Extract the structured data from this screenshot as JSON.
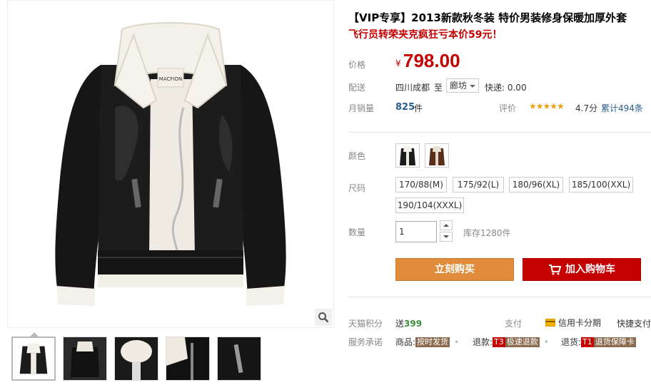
{
  "product": {
    "title": "【VIP专享】2013新款秋冬装 特价男装修身保暖加厚外套",
    "subtitle": "飞行员转荣夹克疯狂亏本价59元！"
  },
  "price": {
    "label": "价格",
    "currency": "¥",
    "value": "798.00"
  },
  "shipping": {
    "label": "配送",
    "from": "四川成都",
    "to_word": "至",
    "destination": "廊坊",
    "postage": "快递: 0.00"
  },
  "sales": {
    "label": "月销量",
    "count": "825",
    "unit": "件",
    "rating_label": "评价",
    "stars": "★★★★★",
    "score": "4.7分",
    "review_count": "累计494条"
  },
  "color": {
    "label": "颜色",
    "options": [
      "black-leather",
      "brown-leather"
    ]
  },
  "size": {
    "label": "尺码",
    "options": [
      "170/88(M)",
      "175/92(L)",
      "180/96(XL)",
      "185/100(XXL)",
      "190/104(XXXL)"
    ]
  },
  "quantity": {
    "label": "数量",
    "value": "1",
    "stock": "库存1280件"
  },
  "buttons": {
    "buy_now": "立刻购买",
    "add_to_cart": "加入购物车"
  },
  "points": {
    "label": "天猫积分",
    "prefix": "送",
    "value": "399"
  },
  "payment": {
    "label": "支付",
    "credit": "信用卡分期",
    "quick": "快捷支付"
  },
  "promise": {
    "label": "服务承诺",
    "goods_label": "商品:",
    "goods_badge": "按时发货",
    "refund_label": "退款:",
    "refund_tag": "T3",
    "refund_badge": "极速退款",
    "return_label": "退货:",
    "return_tag": "T1",
    "return_badge": "退货保障卡"
  },
  "colors": {
    "price": "#c40000",
    "buy": "#e08c3a",
    "cart": "#c40000",
    "link": "#2b5d8f",
    "badge": "#8b6a4e"
  }
}
